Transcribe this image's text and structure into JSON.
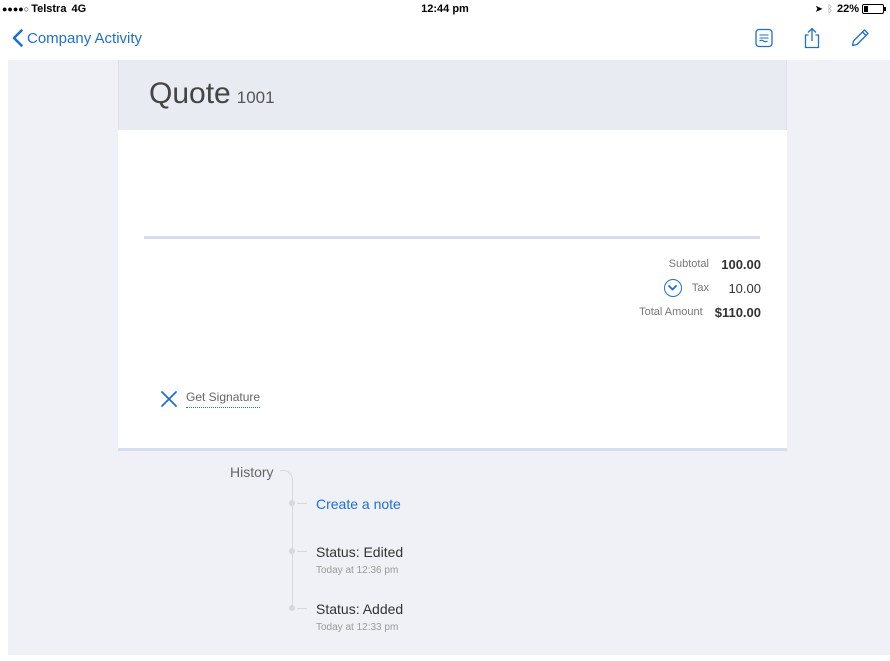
{
  "status_bar": {
    "signal": "●●●●○",
    "carrier": "Telstra",
    "network": "4G",
    "time": "12:44 pm",
    "battery": "22%"
  },
  "nav": {
    "back_label": "Company Activity",
    "accent_color": "#1f6fd3"
  },
  "quote": {
    "title": "Quote",
    "number": "1001",
    "totals": {
      "subtotal_label": "Subtotal",
      "subtotal_value": "100.00",
      "tax_label": "Tax",
      "tax_value": "10.00",
      "total_label": "Total Amount",
      "total_value": "$110.00"
    },
    "signature_label": "Get Signature"
  },
  "history": {
    "label": "History",
    "items": [
      {
        "text": "Create a note",
        "sub": ""
      },
      {
        "text": "Status: Edited",
        "sub": "Today at 12:36 pm"
      },
      {
        "text": "Status: Added",
        "sub": "Today at 12:33 pm"
      }
    ]
  }
}
